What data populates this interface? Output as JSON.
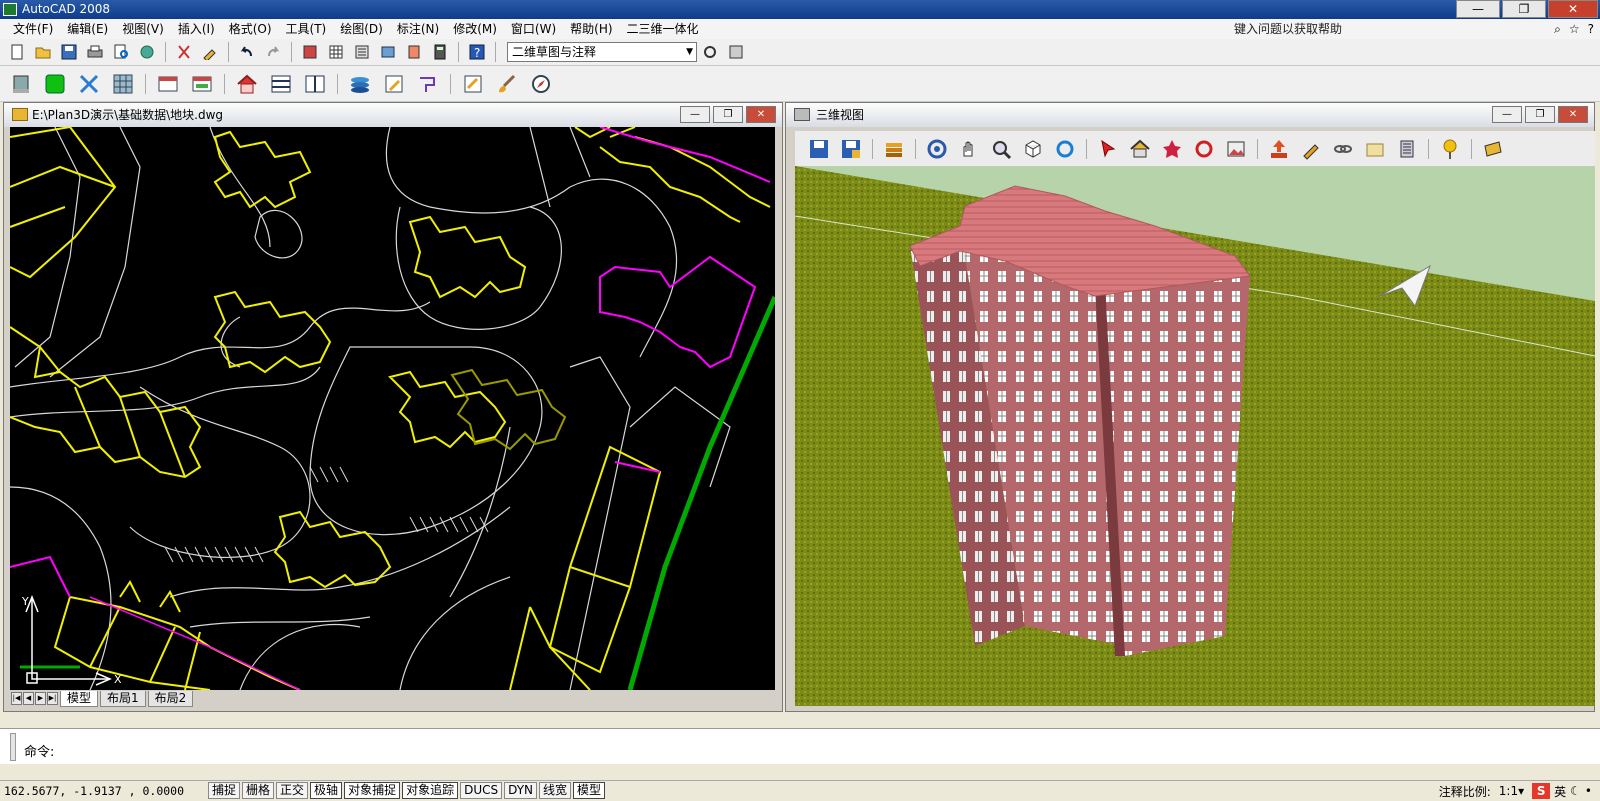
{
  "app": {
    "title": "AutoCAD 2008"
  },
  "window_controls": {
    "minimize": "—",
    "restore": "❐",
    "close": "✕"
  },
  "menu": [
    "文件(F)",
    "编辑(E)",
    "视图(V)",
    "插入(I)",
    "格式(O)",
    "工具(T)",
    "绘图(D)",
    "标注(N)",
    "修改(M)",
    "窗口(W)",
    "帮助(H)",
    "二三维一体化"
  ],
  "help": {
    "placeholder": "键入问题以获取帮助",
    "search_icon": "⌕",
    "star_icon": "☆",
    "help_icon": "?"
  },
  "toolbar1": {
    "icons": [
      "new-icon",
      "open-icon",
      "save-icon",
      "print-icon",
      "preview-icon",
      "publish-icon",
      "cut-icon",
      "matchprop-icon",
      "undo-icon",
      "redo-icon",
      "pan-icon",
      "zoom-icon",
      "properties-icon",
      "designcenter-icon",
      "toolpalette-icon",
      "calculator-icon",
      "help-icon",
      "workspace-icon"
    ],
    "workspace": "二维草图与注释"
  },
  "toolbar2": {
    "icons": [
      "building-icon",
      "green-block-icon",
      "blue-x-icon",
      "grid-icon",
      "window-icon",
      "window2-icon",
      "house-icon",
      "panel-h-icon",
      "panel-v-icon",
      "layers-icon",
      "pencil-icon",
      "polyline-icon",
      "note-icon",
      "brush-icon",
      "compass-icon"
    ]
  },
  "left_doc": {
    "title": "E:\\Plan3D演示\\基础数据\\地块.dwg",
    "tabs": [
      "模型",
      "布局1",
      "布局2"
    ],
    "axis_y": "Y",
    "axis_x": "X"
  },
  "right_doc": {
    "title": "三维视图"
  },
  "view3d_toolbar": {
    "icons": [
      "save-icon",
      "saveas-icon",
      "layers-icon",
      "orbit-icon",
      "pan-hand-icon",
      "zoom-icon",
      "cube-icon",
      "refresh-icon",
      "pointer-icon",
      "home-icon",
      "star-icon",
      "rotate-icon",
      "image-icon",
      "export-icon",
      "pen-icon",
      "link-icon",
      "box-icon",
      "building-icon",
      "pin-icon",
      "sign-icon"
    ]
  },
  "command": {
    "prompt": "命令:"
  },
  "status": {
    "coords": "162.5677, -1.9137 , 0.0000",
    "buttons": [
      "捕捉",
      "栅格",
      "正交",
      "极轴",
      "对象捕捉",
      "对象追踪",
      "DUCS",
      "DYN",
      "线宽",
      "模型"
    ],
    "active": [
      "极轴",
      "对象捕捉",
      "对象追踪",
      "模型"
    ],
    "scale_label": "注释比例:",
    "scale_value": "1:1▾",
    "ime_logo": "S",
    "ime_lang": "英",
    "ime_icons": [
      "moon-icon",
      "dot-icon"
    ]
  },
  "colors": {
    "cad_bg": "#000000",
    "yellow": "#f0f000",
    "magenta": "#ff00ff",
    "green": "#00aa00",
    "roof": "#d9777a",
    "wall": "#b8676a",
    "grass": "#7a8c17",
    "sky": "#b7d3a9"
  }
}
